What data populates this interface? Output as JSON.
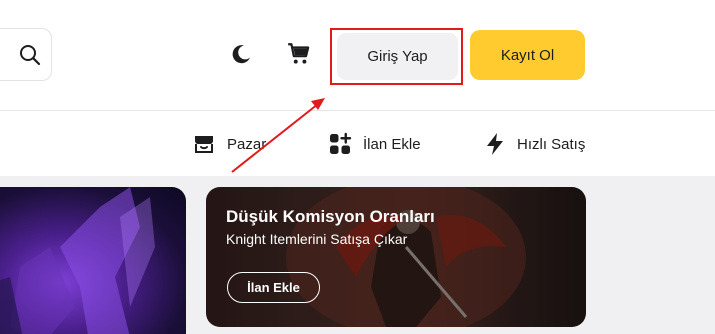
{
  "header": {
    "login_label": "Giriş Yap",
    "register_label": "Kayıt Ol",
    "icons": [
      "search-icon",
      "moon-icon",
      "cart-icon"
    ]
  },
  "nav": {
    "items": [
      {
        "label": "Pazar",
        "icon": "store-icon"
      },
      {
        "label": "İlan Ekle",
        "icon": "grid-plus-icon"
      },
      {
        "label": "Hızlı Satış",
        "icon": "bolt-icon"
      }
    ]
  },
  "banner": {
    "title": "Düşük Komisyon Oranları",
    "subtitle": "Knight Itemlerini Satışa Çıkar",
    "button_label": "İlan Ekle"
  },
  "colors": {
    "accent": "#ffcb2f",
    "highlight": "#e01b1b",
    "login_bg": "#f1f1f3"
  }
}
